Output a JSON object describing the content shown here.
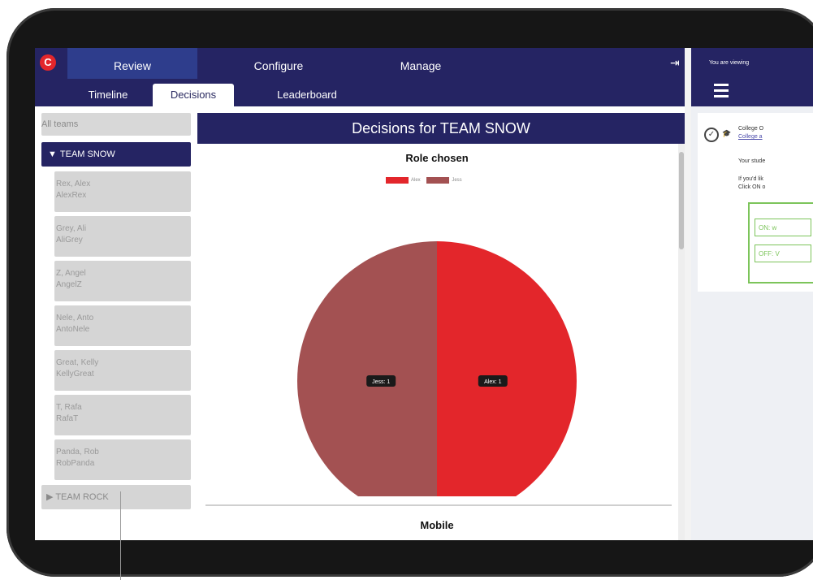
{
  "app": {
    "main_tabs": [
      {
        "label": "Review"
      },
      {
        "label": "Configure"
      },
      {
        "label": "Manage"
      }
    ],
    "sub_tabs": [
      {
        "label": "Timeline"
      },
      {
        "label": "Decisions"
      },
      {
        "label": "Leaderboard"
      }
    ]
  },
  "sidebar": {
    "all_teams": "All teams",
    "team_expanded": "TEAM SNOW",
    "members": [
      {
        "name": "Rex, Alex",
        "user": "AlexRex"
      },
      {
        "name": "Grey, Ali",
        "user": "AliGrey"
      },
      {
        "name": "Z, Angel",
        "user": "AngelZ"
      },
      {
        "name": "Nele, Anto",
        "user": "AntoNele"
      },
      {
        "name": "Great, Kelly",
        "user": "KellyGreat"
      },
      {
        "name": "T, Rafa",
        "user": "RafaT"
      },
      {
        "name": "Panda, Rob",
        "user": "RobPanda"
      }
    ],
    "team_collapsed": "TEAM ROCK"
  },
  "main": {
    "header": "Decisions for TEAM SNOW",
    "section2_title": "Mobile"
  },
  "chart_data": {
    "type": "pie",
    "title": "Role chosen",
    "labels": [
      "Alex",
      "Jess"
    ],
    "values": [
      1,
      1
    ],
    "colors": [
      "#e3262b",
      "#a35152"
    ],
    "data_labels": [
      "Alex: 1",
      "Jess: 1"
    ],
    "legend": "top"
  },
  "right_panel": {
    "top_text": "You are viewing",
    "card_title": "College O",
    "card_link": "College a",
    "line1": "Your stude",
    "line2": "If you'd lik",
    "line3": "Click ON o",
    "btn_on": "ON: w",
    "btn_off": "OFF: V"
  },
  "colors": {
    "navy": "#252463",
    "accent_red": "#e3262b",
    "muted_red": "#a35152",
    "green": "#7cc45a"
  }
}
